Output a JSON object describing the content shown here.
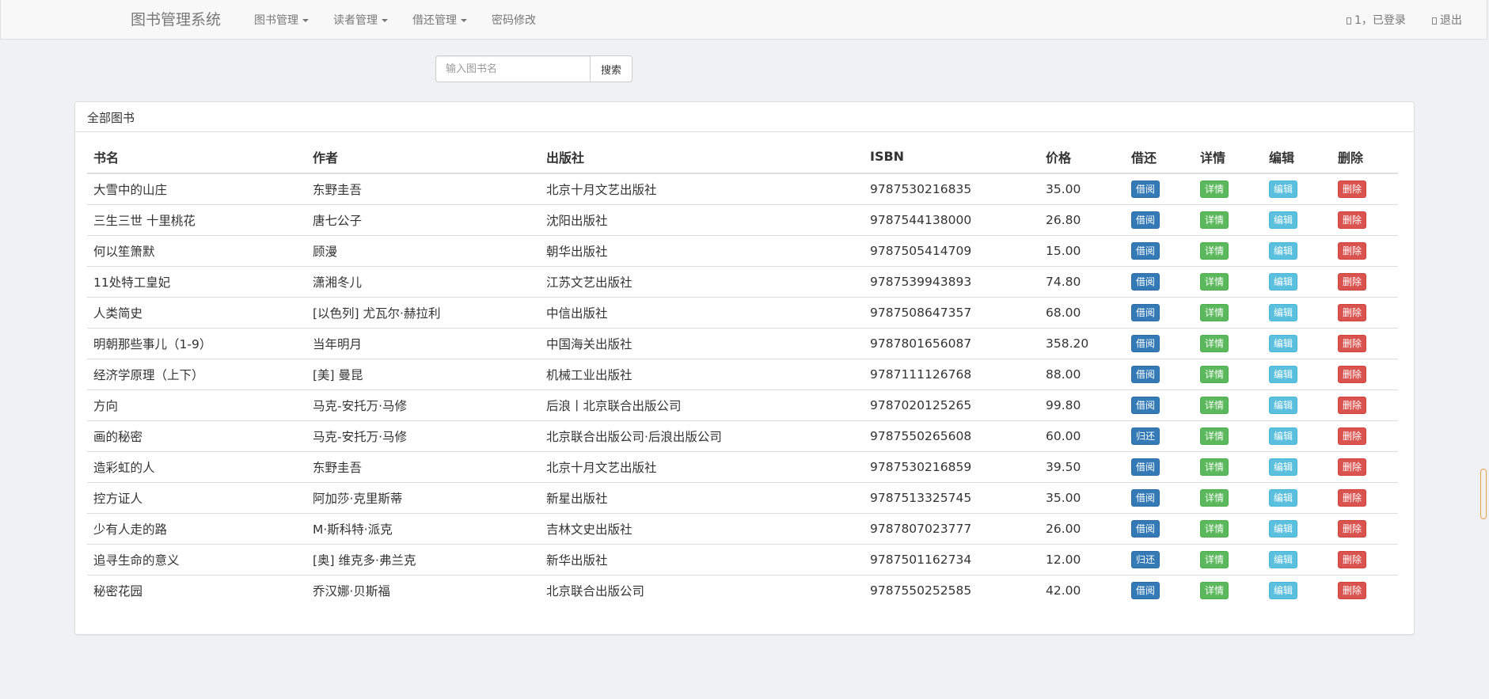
{
  "navbar": {
    "brand": "图书管理系统",
    "menus": [
      {
        "label": "图书管理"
      },
      {
        "label": "读者管理"
      },
      {
        "label": "借还管理"
      },
      {
        "label": "密码修改"
      }
    ],
    "user_status": "1，已登录",
    "logout": "退出"
  },
  "search": {
    "placeholder": "输入图书名",
    "button_label": "搜索"
  },
  "panel": {
    "title": "全部图书"
  },
  "table": {
    "headers": [
      "书名",
      "作者",
      "出版社",
      "ISBN",
      "价格",
      "借还",
      "详情",
      "编辑",
      "删除"
    ],
    "detail_label": "详情",
    "edit_label": "编辑",
    "delete_label": "删除",
    "rows": [
      {
        "title": "大雪中的山庄",
        "author": "东野圭吾",
        "publisher": "北京十月文艺出版社",
        "isbn": "9787530216835",
        "price": "35.00",
        "action": "借阅"
      },
      {
        "title": "三生三世 十里桃花",
        "author": "唐七公子",
        "publisher": "沈阳出版社",
        "isbn": "9787544138000",
        "price": "26.80",
        "action": "借阅"
      },
      {
        "title": "何以笙箫默",
        "author": "顾漫",
        "publisher": "朝华出版社",
        "isbn": "9787505414709",
        "price": "15.00",
        "action": "借阅"
      },
      {
        "title": "11处特工皇妃",
        "author": "潇湘冬儿",
        "publisher": "江苏文艺出版社",
        "isbn": "9787539943893",
        "price": "74.80",
        "action": "借阅"
      },
      {
        "title": "人类简史",
        "author": "[以色列] 尤瓦尔·赫拉利",
        "publisher": "中信出版社",
        "isbn": "9787508647357",
        "price": "68.00",
        "action": "借阅"
      },
      {
        "title": "明朝那些事儿（1-9）",
        "author": "当年明月",
        "publisher": "中国海关出版社",
        "isbn": "9787801656087",
        "price": "358.20",
        "action": "借阅"
      },
      {
        "title": "经济学原理（上下）",
        "author": "[美] 曼昆",
        "publisher": "机械工业出版社",
        "isbn": "9787111126768",
        "price": "88.00",
        "action": "借阅"
      },
      {
        "title": "方向",
        "author": "马克-安托万·马修",
        "publisher": "后浪丨北京联合出版公司",
        "isbn": "9787020125265",
        "price": "99.80",
        "action": "借阅"
      },
      {
        "title": "画的秘密",
        "author": "马克-安托万·马修",
        "publisher": "北京联合出版公司·后浪出版公司",
        "isbn": "9787550265608",
        "price": "60.00",
        "action": "归还"
      },
      {
        "title": "造彩虹的人",
        "author": "东野圭吾",
        "publisher": "北京十月文艺出版社",
        "isbn": "9787530216859",
        "price": "39.50",
        "action": "借阅"
      },
      {
        "title": "控方证人",
        "author": "阿加莎·克里斯蒂",
        "publisher": "新星出版社",
        "isbn": "9787513325745",
        "price": "35.00",
        "action": "借阅"
      },
      {
        "title": "少有人走的路",
        "author": "M·斯科特·派克",
        "publisher": "吉林文史出版社",
        "isbn": "9787807023777",
        "price": "26.00",
        "action": "借阅"
      },
      {
        "title": "追寻生命的意义",
        "author": "[奥] 维克多·弗兰克",
        "publisher": "新华出版社",
        "isbn": "9787501162734",
        "price": "12.00",
        "action": "归还"
      },
      {
        "title": "秘密花园",
        "author": "乔汉娜·贝斯福",
        "publisher": "北京联合出版公司",
        "isbn": "9787550252585",
        "price": "42.00",
        "action": "借阅"
      }
    ]
  },
  "colors": {
    "primary": "#337ab7",
    "success": "#5cb85c",
    "info": "#5bc0de",
    "danger": "#d9534f"
  }
}
